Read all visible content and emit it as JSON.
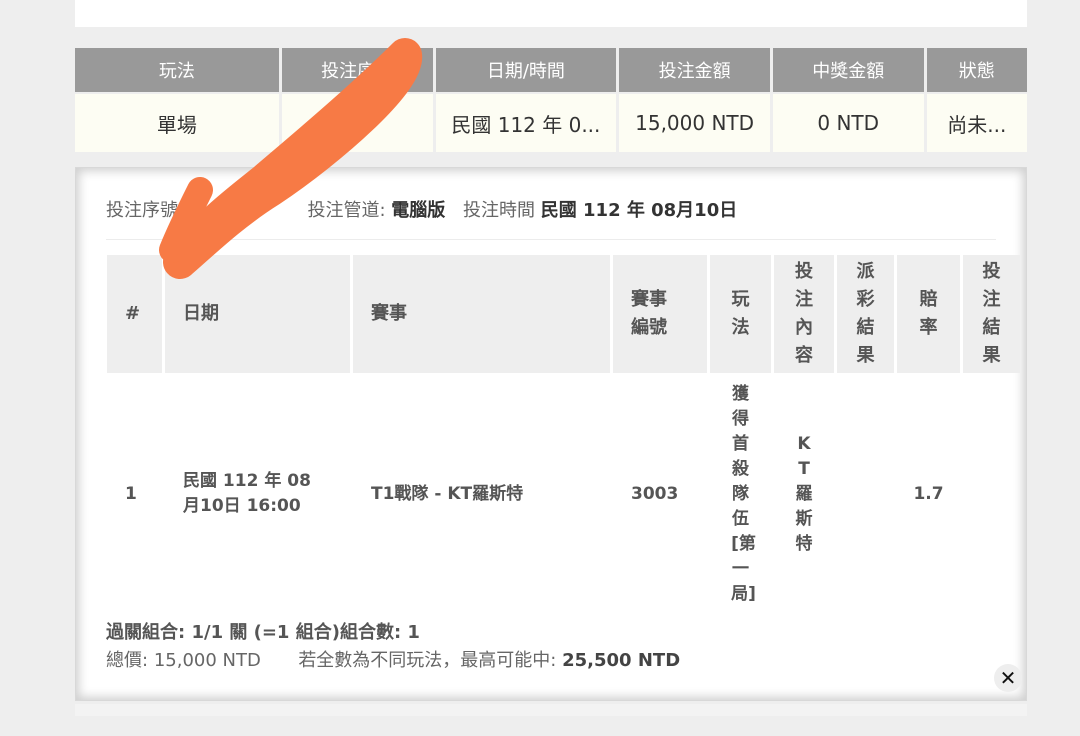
{
  "summary": {
    "headers": [
      "玩法",
      "投注序號",
      "日期/時間",
      "投注金額",
      "中獎金額",
      "狀態"
    ],
    "row": [
      "單場",
      "",
      "民國 112 年 0...",
      "15,000 NTD",
      "0 NTD",
      "尚未..."
    ]
  },
  "meta": {
    "serial_label": "投注序號",
    "channel_label": "投注管道:",
    "channel_value": "電腦版",
    "time_label": "投注時間",
    "time_value": "民國 112 年 08月10日"
  },
  "table": {
    "headers": [
      "#",
      "日期",
      "賽事",
      "賽事編號",
      "玩法",
      "投注內容",
      "派彩結果",
      "賠率",
      "投注結果"
    ],
    "row": {
      "index": "1",
      "date": "民國 112 年 08月10日 16:00",
      "match": "T1戰隊 - KT羅斯特",
      "match_no": "3003",
      "play": "獲得首殺隊伍[第一局]",
      "bet": "KT羅斯特",
      "payout": "",
      "odds": "1.7",
      "result": ""
    }
  },
  "footer": {
    "combo": "過關組合: 1/1 關 (=1 組合)組合數: 1",
    "total_label": "總價:",
    "total_value": "15,000 NTD",
    "max_label": "若全數為不同玩法，最高可能中:",
    "max_value": "25,500 NTD"
  },
  "close_label": "✕",
  "colors": {
    "header_gray": "#999999",
    "scribble": "#f77a45"
  }
}
